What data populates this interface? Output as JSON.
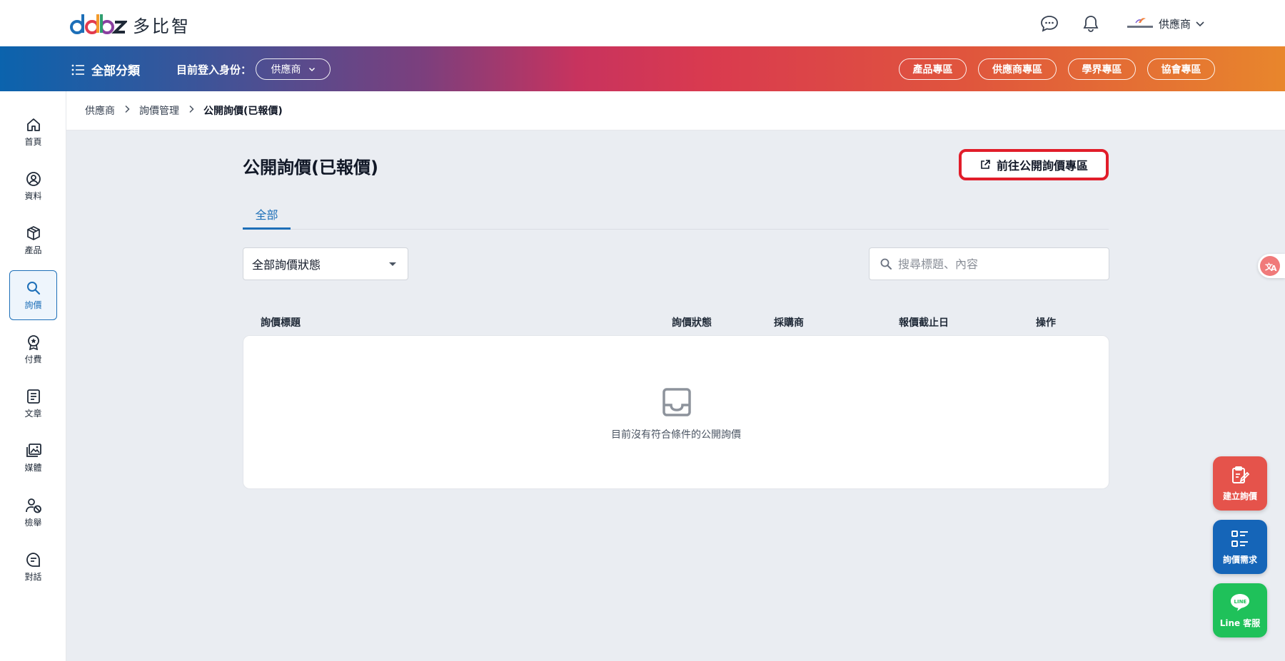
{
  "header": {
    "logo_text": "多比智",
    "user_name": "供應商"
  },
  "navbar": {
    "category_label": "全部分類",
    "role_label": "目前登入身份：",
    "role_value": "供應商",
    "zones": [
      "產品專區",
      "供應商專區",
      "學界專區",
      "協會專區"
    ]
  },
  "sidebar": {
    "items": [
      {
        "label": "首頁",
        "icon": "home-icon"
      },
      {
        "label": "資料",
        "icon": "user-circle-icon"
      },
      {
        "label": "產品",
        "icon": "box-icon"
      },
      {
        "label": "詢價",
        "icon": "search-icon",
        "active": true
      },
      {
        "label": "付費",
        "icon": "award-icon"
      },
      {
        "label": "文章",
        "icon": "document-icon"
      },
      {
        "label": "媒體",
        "icon": "media-icon"
      },
      {
        "label": "檢舉",
        "icon": "report-user-icon"
      },
      {
        "label": "對話",
        "icon": "chat-icon"
      }
    ]
  },
  "breadcrumb": [
    "供應商",
    "詢價管理",
    "公開詢價(已報價)"
  ],
  "main": {
    "title": "公開詢價(已報價)",
    "goto_button": "前往公開詢價專區",
    "tabs": [
      "全部"
    ],
    "status_filter": "全部詢價狀態",
    "search_placeholder": "搜尋標題、內容",
    "columns": [
      "詢價標題",
      "詢價狀態",
      "採購商",
      "報價截止日",
      "操作"
    ],
    "empty_text": "目前沒有符合條件的公開詢價"
  },
  "floating": {
    "create": "建立詢價",
    "needs": "詢價需求",
    "line": "Line 客服",
    "line_logo_text": "LINE"
  },
  "colors": {
    "accent_blue": "#1d6fb8",
    "create_red": "#e5534b",
    "needs_blue": "#1565b8",
    "line_green": "#1fc15a",
    "highlight_red": "#e11d2a"
  }
}
